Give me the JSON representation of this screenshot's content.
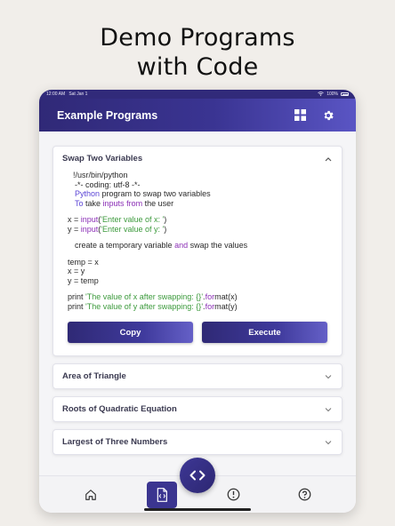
{
  "promo": {
    "title_line1": "Demo Programs",
    "title_line2": "with Code"
  },
  "statusbar": {
    "time": "12:00 AM",
    "date": "Sat Jan 1",
    "battery": "100%"
  },
  "appbar": {
    "title": "Example Programs",
    "icons": [
      "grid-view-icon",
      "gear-icon"
    ]
  },
  "cards": [
    {
      "title": "Swap Two Variables",
      "expanded": true
    },
    {
      "title": "Area of Triangle",
      "expanded": false
    },
    {
      "title": "Roots of Quadratic Equation",
      "expanded": false
    },
    {
      "title": "Largest of Three Numbers",
      "expanded": false
    }
  ],
  "code": {
    "l1": "!/usr/bin/python",
    "l2": "-*- coding: utf-8 -*-",
    "l3a": "Python",
    "l3b": " program to swap two variables",
    "l4a": "To",
    "l4b": " take ",
    "l4c": "inputs",
    "l4d": " ",
    "l4e": "from",
    "l4f": " the user",
    "l5a": "x = ",
    "l5b": "input",
    "l5c": "(",
    "l5d": "'Enter value of x: '",
    "l5e": ")",
    "l6a": "y = ",
    "l6b": "input",
    "l6c": "(",
    "l6d": "'Enter value of y: '",
    "l6e": ")",
    "l7a": "create a temporary variable ",
    "l7b": "and",
    "l7c": " swap the values",
    "l8": "temp = x",
    "l9": "x = y",
    "l10": "y = temp",
    "l11a": "print ",
    "l11b": "'The value of x after swapping: {}'",
    "l11c": ".",
    "l11d": "for",
    "l11e": "mat(x)",
    "l12a": "print ",
    "l12b": "'The value of y after swapping: {}'",
    "l12c": ".",
    "l12d": "for",
    "l12e": "mat(y)"
  },
  "buttons": {
    "copy": "Copy",
    "execute": "Execute"
  },
  "bottom_nav": [
    "home-icon",
    "code-file-icon",
    "info-icon",
    "help-icon"
  ],
  "colors": {
    "primary": "#3a3492",
    "accent": "#5a55c4",
    "keyword": "#8b2fb6",
    "string": "#3c9a3c"
  }
}
